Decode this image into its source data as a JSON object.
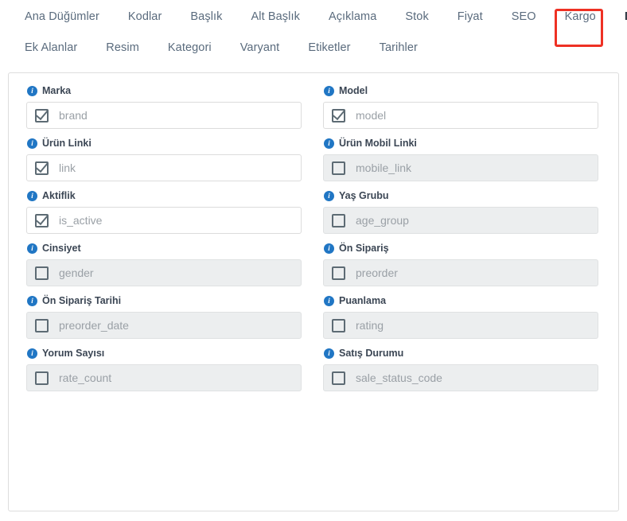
{
  "tabs": {
    "row1": [
      {
        "label": "Ana Düğümler",
        "active": false
      },
      {
        "label": "Kodlar",
        "active": false
      },
      {
        "label": "Başlık",
        "active": false
      },
      {
        "label": "Alt Başlık",
        "active": false
      },
      {
        "label": "Açıklama",
        "active": false
      },
      {
        "label": "Stok",
        "active": false
      },
      {
        "label": "Fiyat",
        "active": false
      },
      {
        "label": "SEO",
        "active": false
      },
      {
        "label": "Kargo",
        "active": false
      },
      {
        "label": "Diğer",
        "active": true
      }
    ],
    "row2": [
      {
        "label": "Ek Alanlar",
        "active": false
      },
      {
        "label": "Resim",
        "active": false
      },
      {
        "label": "Kategori",
        "active": false
      },
      {
        "label": "Varyant",
        "active": false
      },
      {
        "label": "Etiketler",
        "active": false
      },
      {
        "label": "Tarihler",
        "active": false
      }
    ],
    "highlight_label": "Diğer",
    "highlight_color": "#ee3124"
  },
  "icons": {
    "info": "info-icon",
    "checkbox_checked": "checkbox-checked-icon",
    "checkbox_unchecked": "checkbox-unchecked-icon"
  },
  "form": {
    "left": [
      {
        "label": "Marka",
        "placeholder": "brand",
        "checked": true
      },
      {
        "label": "Ürün Linki",
        "placeholder": "link",
        "checked": true
      },
      {
        "label": "Aktiflik",
        "placeholder": "is_active",
        "checked": true
      },
      {
        "label": "Cinsiyet",
        "placeholder": "gender",
        "checked": false
      },
      {
        "label": "Ön Sipariş Tarihi",
        "placeholder": "preorder_date",
        "checked": false
      },
      {
        "label": "Yorum Sayısı",
        "placeholder": "rate_count",
        "checked": false
      }
    ],
    "right": [
      {
        "label": "Model",
        "placeholder": "model",
        "checked": true
      },
      {
        "label": "Ürün Mobil Linki",
        "placeholder": "mobile_link",
        "checked": false
      },
      {
        "label": "Yaş Grubu",
        "placeholder": "age_group",
        "checked": false
      },
      {
        "label": "Ön Sipariş",
        "placeholder": "preorder",
        "checked": false
      },
      {
        "label": "Puanlama",
        "placeholder": "rating",
        "checked": false
      },
      {
        "label": "Satış Durumu",
        "placeholder": "sale_status_code",
        "checked": false
      }
    ]
  },
  "colors": {
    "info_blue": "#2076c4",
    "tab_text": "#5a6b7d",
    "panel_border": "#dddddd",
    "disabled_bg": "#eceeef"
  }
}
